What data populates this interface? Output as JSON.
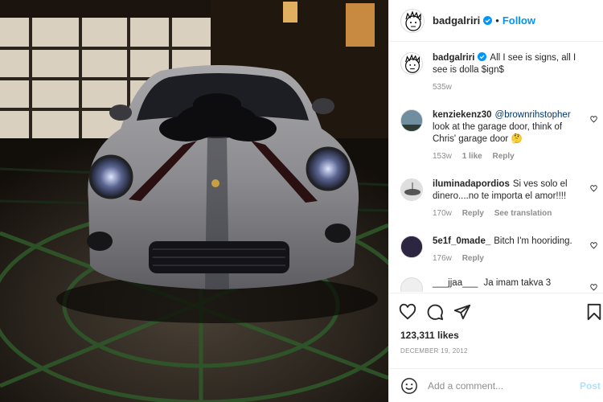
{
  "photo": {
    "description_icon": "car-photo"
  },
  "header": {
    "username": "badgalriri",
    "verified_icon": "verified-badge-icon",
    "separator": "•",
    "follow_label": "Follow"
  },
  "caption": {
    "username": "badgalriri",
    "text": "All I see is signs, all I see is dolla $ign$",
    "time": "535w"
  },
  "comments": [
    {
      "username": "kenziekenz30",
      "mention": "@brownrihstopher",
      "text": "look at the garage door, think of Chris' garage door 🤔",
      "time": "153w",
      "likes": "1 like",
      "reply": "Reply",
      "extra": ""
    },
    {
      "username": "iluminadapordios",
      "mention": "",
      "text": "Si ves solo el dinero....no te importa el amor!!!!",
      "time": "170w",
      "likes": "",
      "reply": "Reply",
      "extra": "See translation"
    },
    {
      "username": "5e1f_0made_",
      "mention": "",
      "text": "Bitch I'm hooriding.",
      "time": "176w",
      "likes": "",
      "reply": "Reply",
      "extra": ""
    },
    {
      "username": "___jjaa___",
      "mention": "",
      "text": "Ja imam takva 3",
      "time": "",
      "likes": "",
      "reply": "",
      "extra": ""
    }
  ],
  "actions": {
    "like_icon": "heart-icon",
    "comment_icon": "comment-icon",
    "share_icon": "send-icon",
    "save_icon": "bookmark-icon"
  },
  "likes": "123,311 likes",
  "date": "DECEMBER 19, 2012",
  "add_comment": {
    "emoji_icon": "emoji-icon",
    "placeholder": "Add a comment...",
    "post_label": "Post"
  },
  "colors": {
    "accent": "#0095f6",
    "post_disabled": "#b2dffc",
    "muted": "#8e8e8e"
  }
}
